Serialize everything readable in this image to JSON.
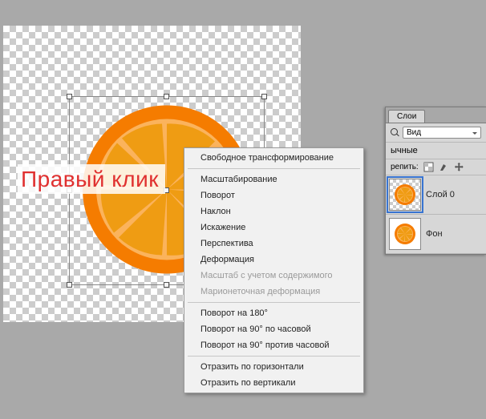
{
  "overlay_text": "Правый клик",
  "context_menu": {
    "items": [
      {
        "label": "Свободное трансформирование",
        "enabled": true
      },
      {
        "sep": true
      },
      {
        "label": "Масштабирование",
        "enabled": true
      },
      {
        "label": "Поворот",
        "enabled": true
      },
      {
        "label": "Наклон",
        "enabled": true
      },
      {
        "label": "Искажение",
        "enabled": true
      },
      {
        "label": "Перспектива",
        "enabled": true
      },
      {
        "label": "Деформация",
        "enabled": true
      },
      {
        "label": "Масштаб с учетом содержимого",
        "enabled": false
      },
      {
        "label": "Марионеточная деформация",
        "enabled": false
      },
      {
        "sep": true
      },
      {
        "label": "Поворот на 180°",
        "enabled": true
      },
      {
        "label": "Поворот на 90° по часовой",
        "enabled": true
      },
      {
        "label": "Поворот на 90° против часовой",
        "enabled": true
      },
      {
        "sep": true
      },
      {
        "label": "Отразить по горизонтали",
        "enabled": true
      },
      {
        "label": "Отразить по вертикали",
        "enabled": true
      }
    ]
  },
  "layers_panel": {
    "tab": "Слои",
    "dropdown_value": "Вид",
    "mode_label": "ычные",
    "lock_label": "репить:",
    "layers": [
      {
        "name": "Слой 0",
        "selected": true
      },
      {
        "name": "Фон",
        "selected": false
      }
    ]
  },
  "colors": {
    "orange_rind": "#f57c00",
    "orange_light": "#fbb35c",
    "orange_segment": "#ef9c13"
  }
}
